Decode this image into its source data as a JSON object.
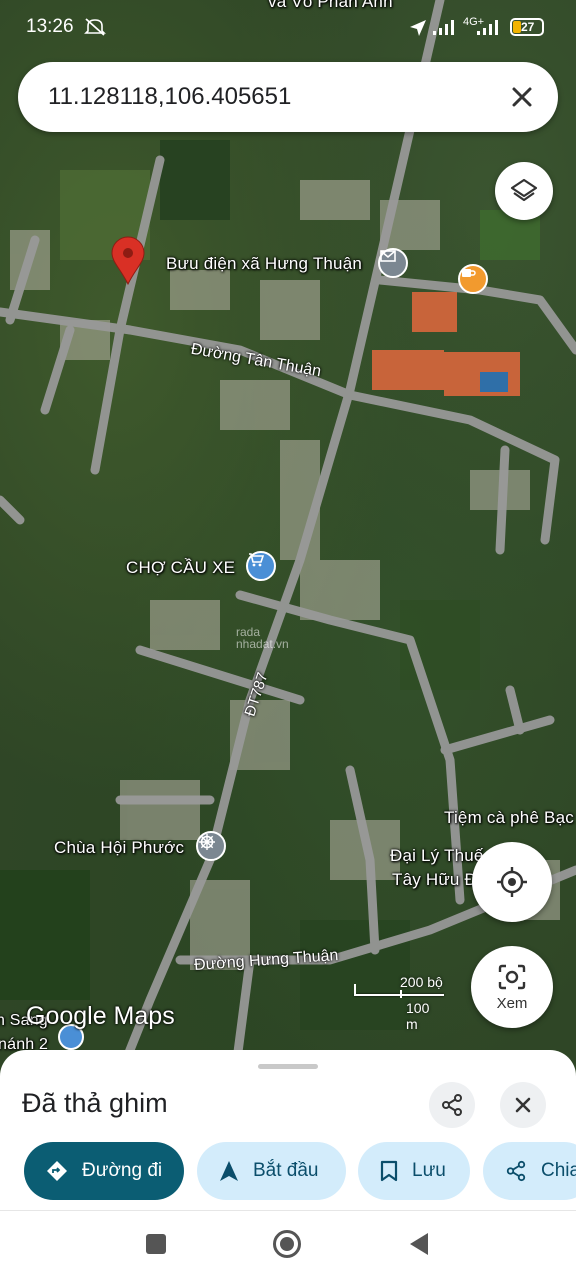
{
  "status_bar": {
    "time": "13:26",
    "network": "4G+",
    "battery": "27",
    "top_map_label": "và Võ Phan Anh"
  },
  "search": {
    "value": "11.128118,106.405651",
    "close_icon": "close-icon"
  },
  "map": {
    "labels": {
      "post_office": "Bưu điện xã Hưng Thuận",
      "market": "CHỢ CẦU XE",
      "pagoda": "Chùa Hội Phước",
      "cafe": "Tiệm cà phê Bạc",
      "agency_line1": "Đại Lý Thuế",
      "agency_line2": "Tây Hữu Đ",
      "bottom_left_line1": "n Sang",
      "bottom_left_line2": "nánh 2"
    },
    "roads": {
      "tan_thuan": "Đường Tân Thuận",
      "hung_thuan": "Đường Hưng Thuận",
      "dt787": "ĐT787"
    },
    "watermark": {
      "line1": "rada",
      "line2": "nhadat.vn"
    },
    "logo": "Google Maps",
    "scale": {
      "imperial": "200 bộ",
      "metric": "100 m"
    },
    "view_button_label": "Xem",
    "icons": {
      "pin": "red-pin-icon",
      "post_office": "mail-icon",
      "cafe": "coffee-icon",
      "market": "shopping-cart-icon",
      "pagoda": "dharma-wheel-icon",
      "layers": "layers-icon",
      "location": "my-location-icon",
      "lens": "lens-icon"
    },
    "colors": {
      "pin": "#d93025",
      "poi_blue": "#4a8fd6",
      "poi_orange": "#f29a2e",
      "poi_grey": "#7b8791"
    }
  },
  "sheet": {
    "title": "Đã thả ghim",
    "share_icon": "share-icon",
    "close_icon": "close-icon",
    "chips": [
      {
        "label": "Đường đi",
        "icon": "directions-icon"
      },
      {
        "label": "Bắt đầu",
        "icon": "navigation-arrow-icon"
      },
      {
        "label": "Lưu",
        "icon": "bookmark-icon"
      },
      {
        "label": "Chia",
        "icon": "share-icon"
      }
    ],
    "colors": {
      "primary_chip": "#0b5d73",
      "secondary_chip": "#d3ecfb"
    }
  },
  "nav_bar": {
    "recent": "square-icon",
    "home": "circle-icon",
    "back": "triangle-back-icon"
  }
}
